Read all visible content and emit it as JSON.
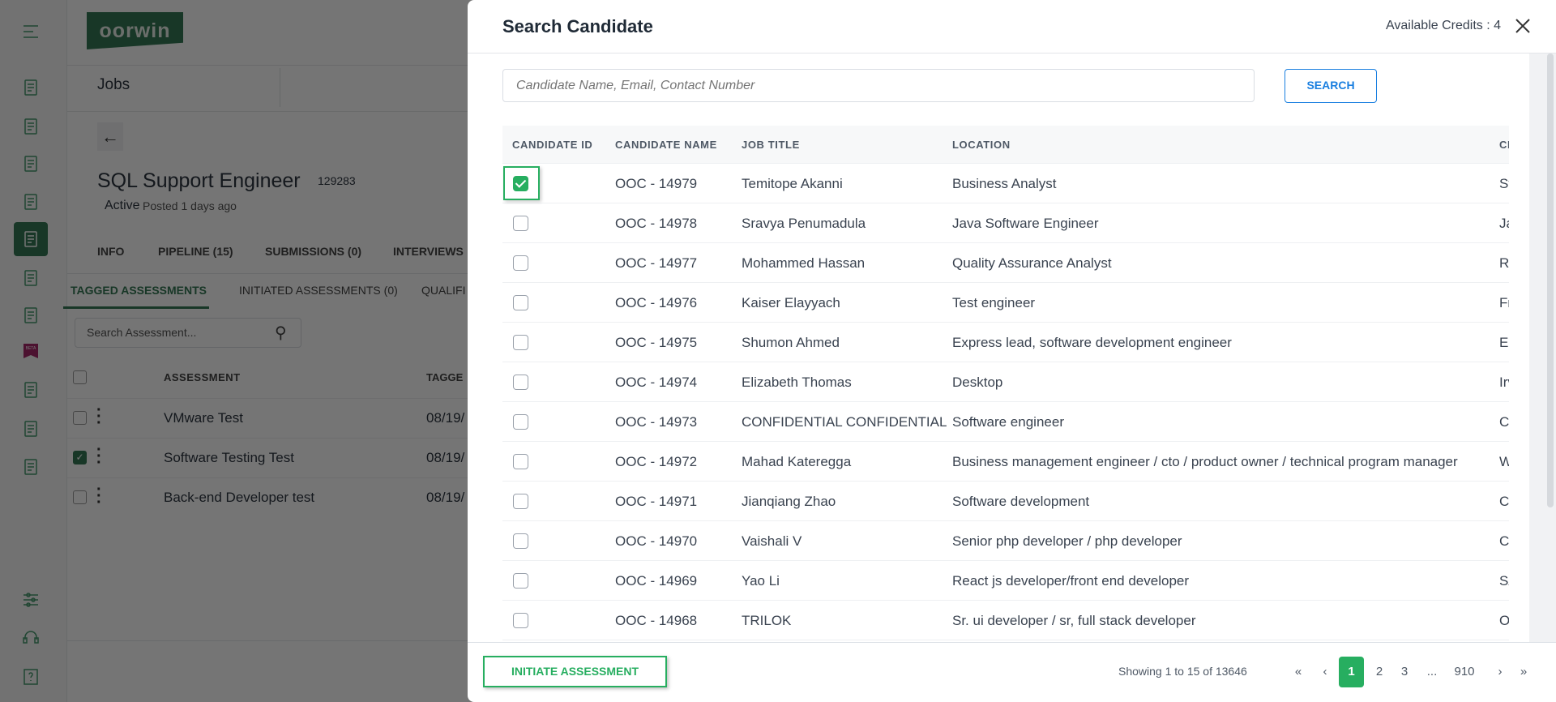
{
  "background": {
    "logo_text": "oorwin",
    "header_title": "Jobs",
    "job": {
      "title": "SQL Support Engineer",
      "id": "129283",
      "status": "Active",
      "posted": "Posted 1 days ago"
    },
    "tabs": [
      "INFO",
      "PIPELINE (15)",
      "SUBMISSIONS (0)",
      "INTERVIEWS"
    ],
    "sub_tabs": [
      "TAGGED ASSESSMENTS",
      "INITIATED ASSESSMENTS (0)",
      "QUALIFI"
    ],
    "active_sub_tab": "TAGGED ASSESSMENTS",
    "search_placeholder": "Search Assessment...",
    "beta_badge": "BETA",
    "table": {
      "headers": [
        "ASSESSMENT",
        "TAGGE"
      ],
      "rows": [
        {
          "name": "VMware Test",
          "date": "08/19/",
          "checked": false
        },
        {
          "name": "Software Testing Test",
          "date": "08/19/",
          "checked": true
        },
        {
          "name": "Back-end Developer test",
          "date": "08/19/",
          "checked": false
        }
      ]
    },
    "sidebar_icons": [
      "menu-icon",
      "dashboard-icon",
      "contacts-icon",
      "phone-book-icon",
      "briefcase-icon",
      "job-location-icon",
      "users-clock-icon",
      "layers-icon",
      "beta-icon",
      "report-chart-icon",
      "calendar-grid-icon",
      "documents-icon",
      "sliders-icon",
      "headset-icon",
      "help-book-icon"
    ]
  },
  "modal": {
    "title": "Search Candidate",
    "credits": "Available Credits : 4",
    "search_placeholder": "Candidate Name, Email, Contact Number",
    "search_value": "",
    "search_button": "SEARCH",
    "columns": [
      "CANDIDATE ID",
      "CANDIDATE NAME",
      "JOB TITLE",
      "LOCATION",
      "CR"
    ],
    "rows": [
      {
        "checked": true,
        "id": "OOC - 14979",
        "name": "Temitope Akanni",
        "title": "Business Analyst",
        "extra": "Sta"
      },
      {
        "checked": false,
        "id": "OOC - 14978",
        "name": "Sravya Penumadula",
        "title": "Java Software Engineer",
        "extra": "Jac"
      },
      {
        "checked": false,
        "id": "OOC - 14977",
        "name": "Mohammed Hassan",
        "title": "Quality Assurance Analyst",
        "extra": "Ric"
      },
      {
        "checked": false,
        "id": "OOC - 14976",
        "name": "Kaiser Elayyach",
        "title": "Test engineer",
        "extra": "Fri"
      },
      {
        "checked": false,
        "id": "OOC - 14975",
        "name": "Shumon Ahmed",
        "title": "Express lead, software development engineer",
        "extra": "Elr"
      },
      {
        "checked": false,
        "id": "OOC - 14974",
        "name": "Elizabeth Thomas",
        "title": "Desktop",
        "extra": "Irv"
      },
      {
        "checked": false,
        "id": "OOC - 14973",
        "name": "CONFIDENTIAL CONFIDENTIAL",
        "title": "Software engineer",
        "extra": "CC"
      },
      {
        "checked": false,
        "id": "OOC - 14972",
        "name": "Mahad Kateregga",
        "title": "Business management engineer / cto / product owner / technical program manager",
        "extra": "Wc"
      },
      {
        "checked": false,
        "id": "OOC - 14971",
        "name": "Jianqiang Zhao",
        "title": "Software development",
        "extra": "Ca"
      },
      {
        "checked": false,
        "id": "OOC - 14970",
        "name": "Vaishali V",
        "title": "Senior php developer / php developer",
        "extra": "Ca"
      },
      {
        "checked": false,
        "id": "OOC - 14969",
        "name": "Yao Li",
        "title": "React js developer/front end developer",
        "extra": "SA"
      },
      {
        "checked": false,
        "id": "OOC - 14968",
        "name": "TRILOK",
        "title": "Sr. ui developer / sr, full stack developer",
        "extra": "Oh"
      }
    ],
    "initiate_button": "INITIATE ASSESSMENT",
    "pagination": {
      "summary": "Showing 1 to 15 of 13646",
      "first": "«",
      "prev": "‹",
      "next": "›",
      "last": "»",
      "pages": [
        "1",
        "2",
        "3",
        "...",
        "910"
      ],
      "current": "1"
    }
  },
  "colors": {
    "brand_green": "#2f7a52",
    "accent_green": "#27ae60",
    "search_blue": "#1a7fe0"
  }
}
